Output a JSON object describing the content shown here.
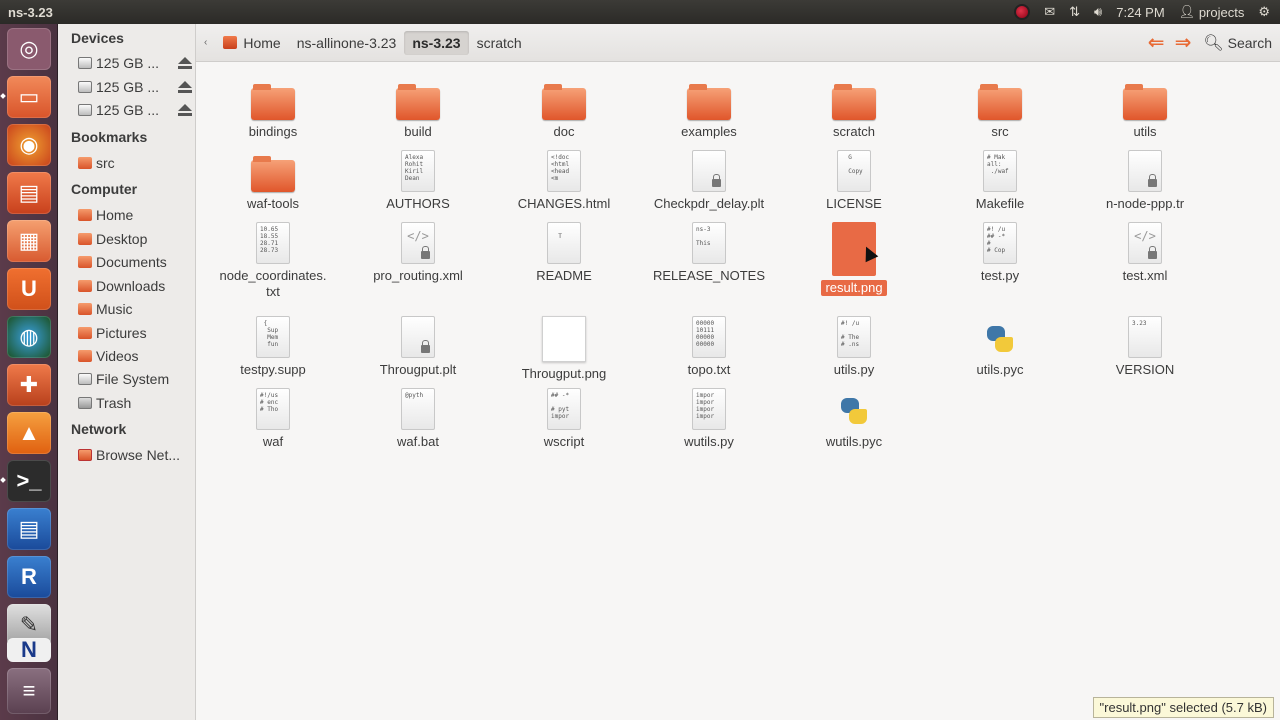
{
  "window": {
    "title": "ns-3.23"
  },
  "tray": {
    "time": "7:24 PM",
    "user": "projects"
  },
  "sidebar": {
    "devices_label": "Devices",
    "devices": [
      {
        "label": "125 GB ..."
      },
      {
        "label": "125 GB ..."
      },
      {
        "label": "125 GB ..."
      }
    ],
    "bookmarks_label": "Bookmarks",
    "bookmarks": [
      {
        "label": "src"
      }
    ],
    "computer_label": "Computer",
    "computer": [
      {
        "label": "Home"
      },
      {
        "label": "Desktop"
      },
      {
        "label": "Documents"
      },
      {
        "label": "Downloads"
      },
      {
        "label": "Music"
      },
      {
        "label": "Pictures"
      },
      {
        "label": "Videos"
      },
      {
        "label": "File System"
      },
      {
        "label": "Trash"
      }
    ],
    "network_label": "Network",
    "network": [
      {
        "label": "Browse Net..."
      }
    ]
  },
  "toolbar": {
    "crumbs": [
      "Home",
      "ns-allinone-3.23",
      "ns-3.23",
      "scratch"
    ],
    "search_label": "Search"
  },
  "files": [
    {
      "name": "bindings",
      "kind": "folder"
    },
    {
      "name": "build",
      "kind": "folder"
    },
    {
      "name": "doc",
      "kind": "folder"
    },
    {
      "name": "examples",
      "kind": "folder"
    },
    {
      "name": "scratch",
      "kind": "folder"
    },
    {
      "name": "src",
      "kind": "folder"
    },
    {
      "name": "utils",
      "kind": "folder"
    },
    {
      "name": "waf-tools",
      "kind": "folder"
    },
    {
      "name": "AUTHORS",
      "kind": "text",
      "preview": "Alexa\nRohit\nKiril\nDean"
    },
    {
      "name": "CHANGES.html",
      "kind": "text",
      "preview": "<!doc\n<html\n<head\n<m"
    },
    {
      "name": "Checkpdr_delay.plt",
      "kind": "locked"
    },
    {
      "name": "LICENSE",
      "kind": "text",
      "preview": "  G\n\n  Copy"
    },
    {
      "name": "Makefile",
      "kind": "text",
      "preview": "# Mak\nall:\n ./waf"
    },
    {
      "name": "n-node-ppp.tr",
      "kind": "locked"
    },
    {
      "name": "node_coordinates.\ntxt",
      "kind": "text",
      "preview": "10.65\n18.55\n28.71\n28.73"
    },
    {
      "name": "pro_routing.xml",
      "kind": "xml"
    },
    {
      "name": "README",
      "kind": "text",
      "preview": "\n  T"
    },
    {
      "name": "RELEASE_NOTES",
      "kind": "text",
      "preview": "ns-3\n\nThis"
    },
    {
      "name": "result.png",
      "kind": "selected"
    },
    {
      "name": "test.py",
      "kind": "text",
      "preview": "#! /u\n## -*\n#\n# Cop"
    },
    {
      "name": "test.xml",
      "kind": "xml"
    },
    {
      "name": "testpy.supp",
      "kind": "text",
      "preview": " {\n  Sup\n  Mem\n  fun"
    },
    {
      "name": "Througput.plt",
      "kind": "locked"
    },
    {
      "name": "Througput.png",
      "kind": "thumb"
    },
    {
      "name": "topo.txt",
      "kind": "text",
      "preview": "00000\n10111\n00000\n00000"
    },
    {
      "name": "utils.py",
      "kind": "text",
      "preview": "#! /u\n\n# The\n# .ns"
    },
    {
      "name": "utils.pyc",
      "kind": "python"
    },
    {
      "name": "VERSION",
      "kind": "text",
      "preview": "3.23"
    },
    {
      "name": "waf",
      "kind": "text",
      "preview": "#!/us\n# enc\n# Tho"
    },
    {
      "name": "waf.bat",
      "kind": "text",
      "preview": "@pyth"
    },
    {
      "name": "wscript",
      "kind": "text",
      "preview": "## -*\n\n# pyt\nimpor"
    },
    {
      "name": "wutils.py",
      "kind": "text",
      "preview": "impor\nimpor\nimpor\nimpor"
    },
    {
      "name": "wutils.pyc",
      "kind": "python"
    }
  ],
  "status": {
    "text": "\"result.png\" selected (5.7 kB)"
  },
  "colors": {
    "accent": "#e86a45",
    "panel": "#3c3b37",
    "launcher": "#5b3b4a"
  },
  "launcher_icons": [
    "ubuntu-dash-icon",
    "files-icon",
    "firefox-icon",
    "impress-icon",
    "software-center-icon",
    "ubuntu-one-icon",
    "globe-icon",
    "settings-icon",
    "vlc-icon",
    "terminal-icon",
    "writer-icon",
    "r-icon",
    "editor-icon",
    "nam-icon",
    "trash-stack-icon"
  ]
}
